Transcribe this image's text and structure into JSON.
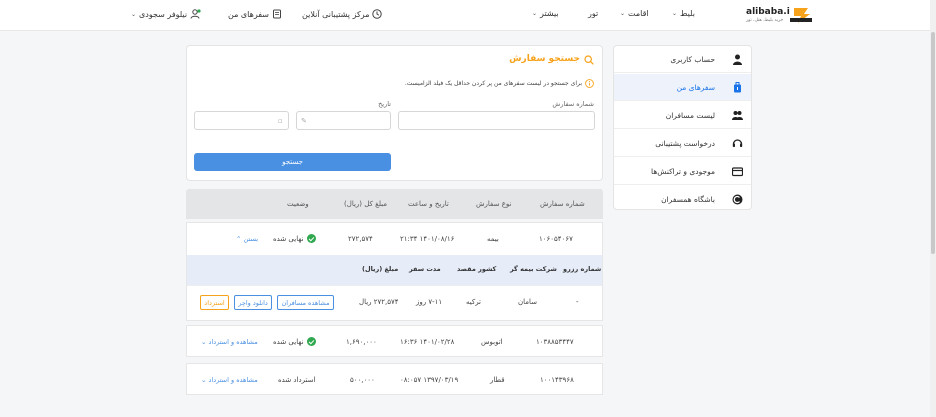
{
  "header": {
    "logo_text": "alibaba.ir",
    "logo_sub": "خرید بلیط، هتل، تور",
    "nav": {
      "ticket": "بلیط",
      "stay": "اقامت",
      "tour": "تور",
      "more": "بیشتر"
    },
    "support": "مرکز پشتیبانی آنلاین",
    "my_trips": "سفرهای من",
    "user": "نیلوفر سجودی"
  },
  "sidebar": {
    "items": [
      {
        "label": "حساب کاربری",
        "icon": "user-icon"
      },
      {
        "label": "سفرهای من",
        "icon": "suitcase-icon",
        "active": true
      },
      {
        "label": "لیست مسافران",
        "icon": "users-icon"
      },
      {
        "label": "درخواست پشتیبانی",
        "icon": "headset-icon"
      },
      {
        "label": "موجودی و تراکنش‌ها",
        "icon": "wallet-icon"
      },
      {
        "label": "باشگاه همسفران",
        "icon": "club-icon"
      }
    ]
  },
  "search": {
    "title": "جستجو سفارش",
    "info": "برای جستجو در لیست سفرهای من پر کردن حداقل یک فیلد الزامیست.",
    "order_number_label": "شماره سفارش",
    "date_label": "تاریخ",
    "button": "جستجو"
  },
  "table": {
    "headers": {
      "order_no": "شماره سفارش",
      "type": "نوع سفارش",
      "datetime": "تاریخ و ساعت",
      "total": "مبلغ کل (ریال)",
      "status": "وضعیت"
    },
    "rows": [
      {
        "order_no": "۱۰۶۰۵۴۰۶۷",
        "type": "بیمه",
        "datetime": "۱۴۰۱/۰۸/۱۶ ۲۱:۳۴",
        "total": "۲۷۲,۵۷۴",
        "status": "نهایی شده",
        "action": "بستن",
        "status_ok": true
      },
      {
        "order_no": "۱۰۳۸۸۵۳۴۴۷",
        "type": "اتوبوس",
        "datetime": "۱۴۰۱/۰۲/۲۸ ۱۶:۳۶",
        "total": "۱,۶۹۰,۰۰۰",
        "status": "نهایی شده",
        "action": "مشاهده و استرداد",
        "status_ok": true
      },
      {
        "order_no": "۱۰۰۱۴۳۹۶۸",
        "type": "قطار",
        "datetime": "۱۳۹۷/۰۳/۱۹ ۰۸:۰۵۷",
        "total": "۵۰۰,۰۰۰",
        "status": "استرداد شده",
        "action": "مشاهده و استرداد",
        "status_ok": false
      }
    ],
    "detail": {
      "headers": {
        "ref": "شماره رزرو",
        "insurer": "شرکت بیمه گر",
        "country": "کشور مقصد",
        "duration": "مدت سفر",
        "amount": "مبلغ (ریال)"
      },
      "row": {
        "ref": "-",
        "insurer": "سامان",
        "country": "ترکیه",
        "duration": "۷-۱۱ روز",
        "amount": "۲۷۲,۵۷۴ ریال"
      },
      "buttons": {
        "view_passengers": "مشاهده مسافران",
        "download_voucher": "دانلود واچر",
        "refund": "استرداد"
      }
    }
  },
  "colors": {
    "accent": "#4a90e2",
    "title": "#f7a21b",
    "success": "#2fa84f"
  }
}
